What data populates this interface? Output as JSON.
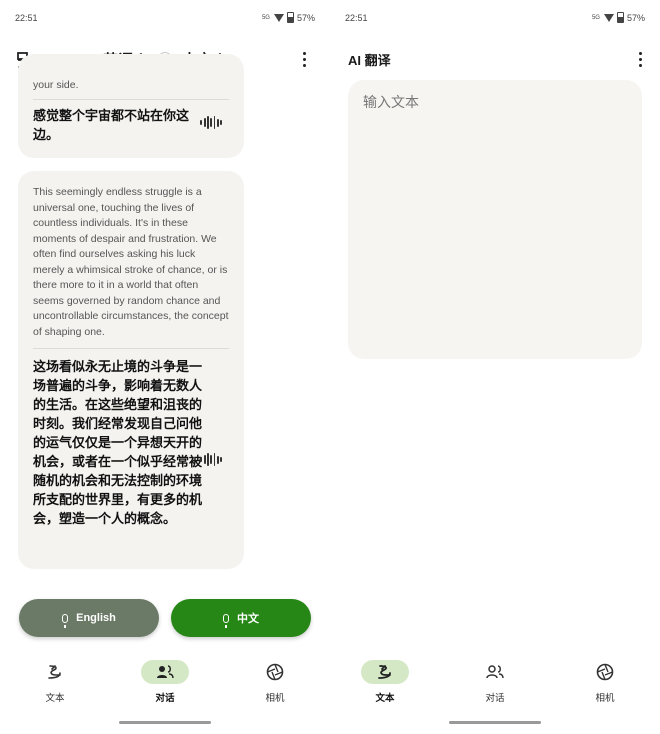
{
  "status_bar": {
    "time": "22:51",
    "signal": "5G",
    "battery": "57%"
  },
  "left_screen": {
    "source_language": "英语",
    "target_language": "中文",
    "conversations": [
      {
        "source_text": "your side.",
        "translation": "感觉整个宇宙都不站在你这边。"
      },
      {
        "source_text": " This seemingly endless struggle is a universal one, touching the lives of countless individuals. It's in these moments of despair and frustration. We often find ourselves asking his luck merely a whimsical stroke of chance, or is there more to it in a world that often seems governed by random chance and uncontrollable circumstances, the concept of shaping one.",
        "translation": "这场看似永无止境的斗争是一场普遍的斗争，影响着无数人的生活。在这些绝望和沮丧的时刻。我们经常发现自己问他的运气仅仅是一个异想天开的机会，或者在一个似乎经常被随机的机会和无法控制的环境所支配的世界里，有更多的机会，塑造一个人的概念。"
      }
    ],
    "buttons": {
      "english": "English",
      "chinese": "中文"
    },
    "nav": [
      {
        "label": "文本",
        "icon": "text-translate-icon"
      },
      {
        "label": "对话",
        "icon": "conversation-icon"
      },
      {
        "label": "相机",
        "icon": "camera-icon"
      }
    ],
    "active_nav": "对话"
  },
  "right_screen": {
    "title": "AI 翻译",
    "input_placeholder": "输入文本",
    "nav": [
      {
        "label": "文本",
        "icon": "text-translate-icon"
      },
      {
        "label": "对话",
        "icon": "conversation-icon"
      },
      {
        "label": "相机",
        "icon": "camera-icon"
      }
    ],
    "active_nav": "文本"
  },
  "colors": {
    "english_button": "#6b7a66",
    "chinese_button": "#268716",
    "active_nav_bg": "#d4e8c6",
    "card_bg": "#f4f3f0"
  }
}
